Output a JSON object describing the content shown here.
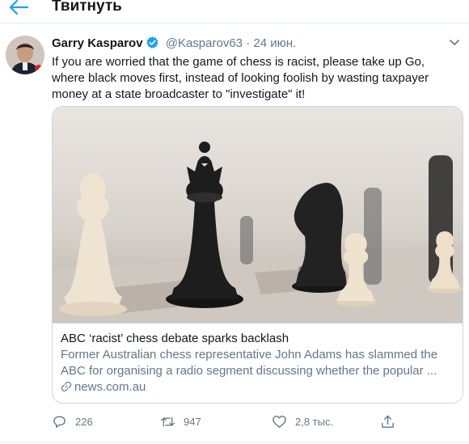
{
  "header": {
    "title": "Твитнуть",
    "back_icon": "arrow-left-icon",
    "accent": "#1da1f2"
  },
  "tweet": {
    "author_name": "Garry Kasparov",
    "handle": "@Kasparov63",
    "separator": "·",
    "date": "24 июн.",
    "text": "If you are worried that the game of chess is racist, please take up Go, where black moves first, instead of looking foolish by wasting taxpayer money at a state broadcaster to \"investigate\" it!"
  },
  "card": {
    "title": "ABC ‘racist’ chess debate sparks backlash",
    "description_line1": "Former Australian chess representative John Adams has slammed the",
    "description_line2": "ABC for organising a radio segment discussing whether the popular ...",
    "domain": "news.com.au"
  },
  "actions": {
    "replies": "226",
    "retweets": "947",
    "likes": "2,8 тыс."
  },
  "colors": {
    "text": "#14171a",
    "secondary": "#657786",
    "border": "#ccd6dd",
    "verified": "#1da1f2"
  }
}
